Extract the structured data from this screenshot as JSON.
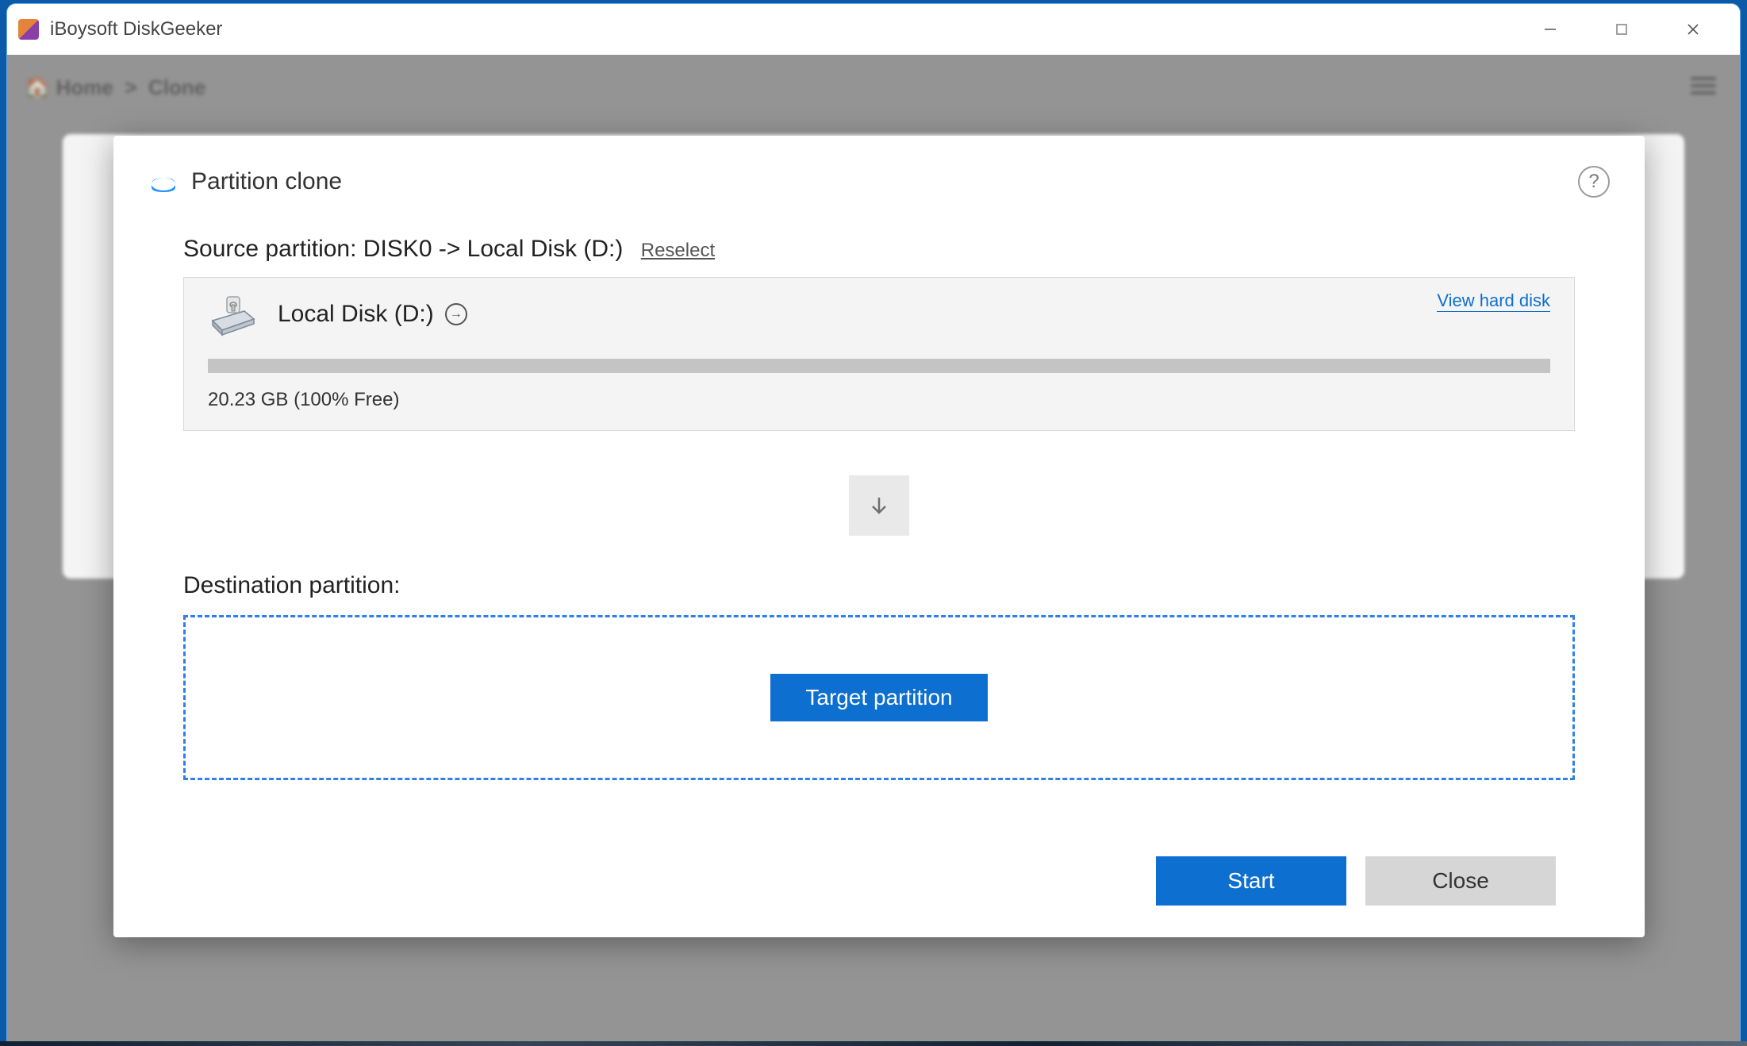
{
  "app": {
    "title": "iBoysoft DiskGeeker"
  },
  "background": {
    "breadcrumb_home": "Home",
    "breadcrumb_sep": ">",
    "breadcrumb_current": "Clone"
  },
  "dialog": {
    "title": "Partition clone",
    "help_symbol": "?",
    "source": {
      "label_prefix": "Source partition: ",
      "path": "DISK0 -> Local Disk (D:)",
      "reselect": "Reselect",
      "drive_name": "Local Disk (D:)",
      "view_hard_disk": "View hard disk",
      "usage_text": "20.23 GB (100% Free)"
    },
    "destination": {
      "label": "Destination partition:",
      "target_button": "Target partition"
    },
    "actions": {
      "start": "Start",
      "close": "Close"
    }
  }
}
